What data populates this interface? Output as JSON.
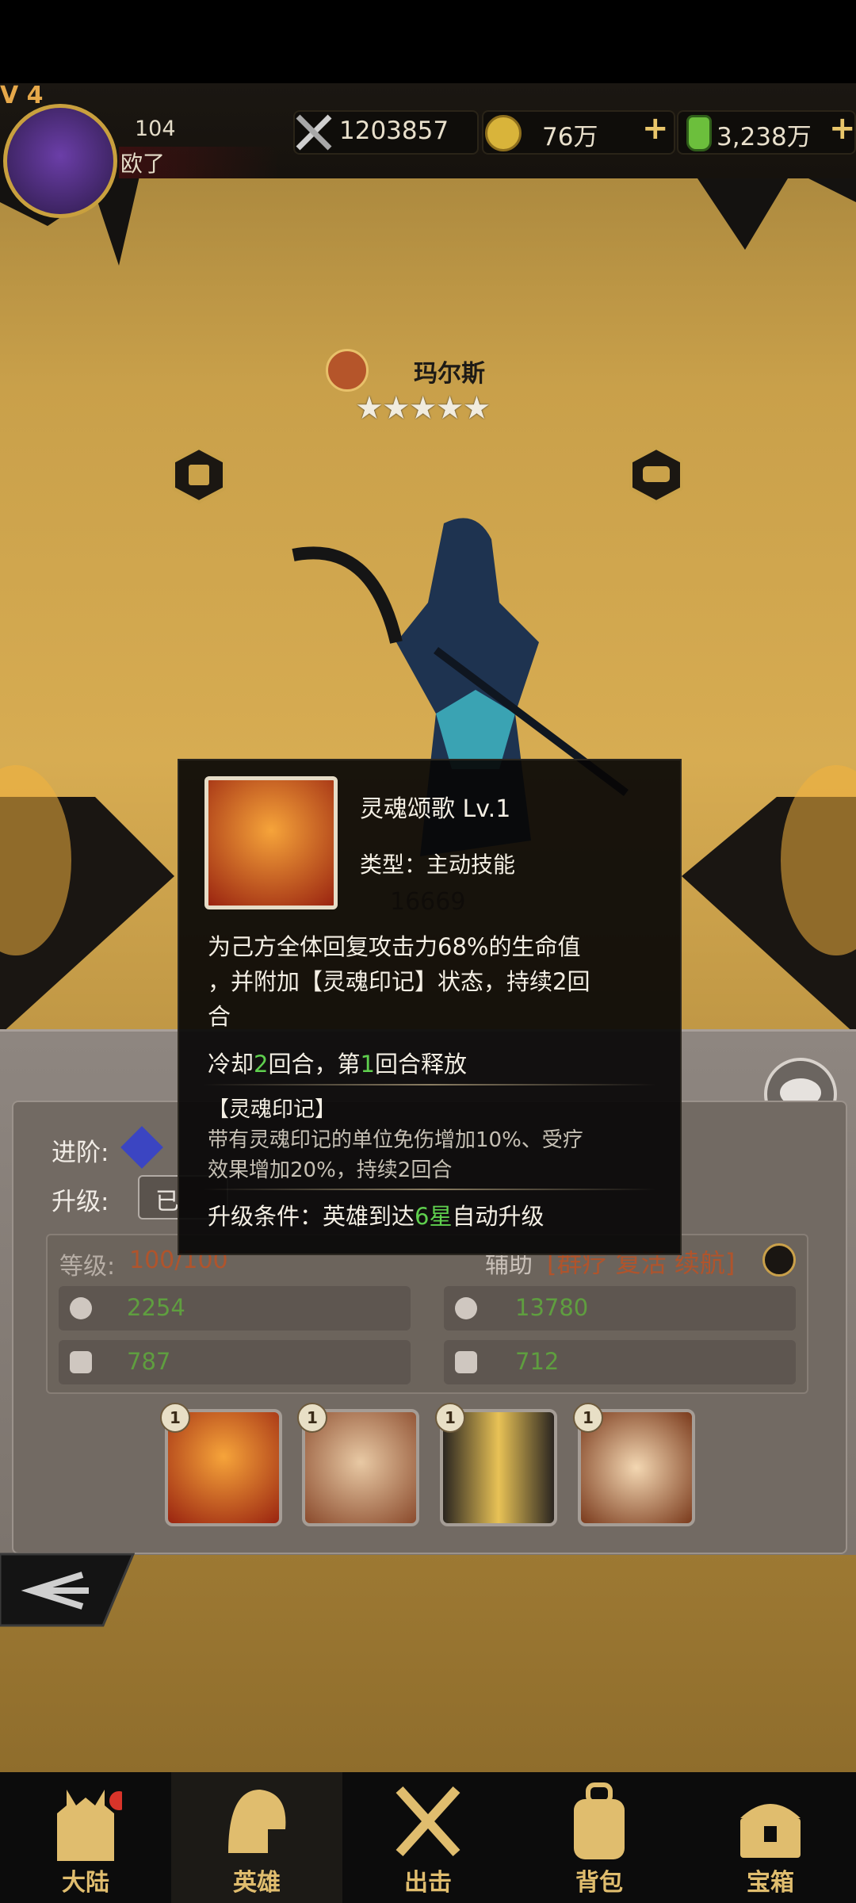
{
  "player": {
    "level_label": "V 4",
    "power": "104",
    "name": "欧了"
  },
  "currencies": {
    "combat_power": "1203857",
    "gold": "76万",
    "potion": "3,238万",
    "plus_symbol": "+"
  },
  "hero": {
    "name": "玛尔斯",
    "stars": [
      "★",
      "★",
      "★",
      "★",
      "★"
    ],
    "hidden_power": "16669"
  },
  "tooltip": {
    "skill_name": "灵魂颂歌 Lv.1",
    "type_label": "类型：主动技能",
    "description_l1": "为己方全体回复攻击力68%的生命值",
    "description_l2": "，并附加【灵魂印记】状态，持续2回",
    "description_l3": "合",
    "cooldown_a": "冷却",
    "cooldown_b": "2",
    "cooldown_c": "回合，第",
    "cooldown_d": "1",
    "cooldown_e": "回合释放",
    "mark_title": "【灵魂印记】",
    "mark_l1": "带有灵魂印记的单位免伤增加10%、受疗",
    "mark_l2": "效果增加20%，持续2回合",
    "upgrade_a": "升级条件：英雄到达",
    "upgrade_b": "6星",
    "upgrade_c": "自动升级"
  },
  "panel": {
    "advance_label": "进阶:",
    "upgrade_label": "升级:",
    "upgrade_btn": "已",
    "level_label": "等级:",
    "level_value": "100/100",
    "role_label": "辅助",
    "role_tags": "[群疗 复活 续航]",
    "attack": "2254",
    "hp": "13780",
    "defense": "787",
    "speed": "712",
    "skill_levels": [
      "1",
      "1",
      "1",
      "1"
    ]
  },
  "nav": {
    "items": [
      "大陆",
      "英雄",
      "出击",
      "背包",
      "宝箱"
    ]
  },
  "colors": {
    "accent_gold": "#e0bd6e",
    "green_text": "#5fcf4e",
    "stat_green": "#5f9e3f",
    "level_orange": "#b0542c"
  },
  "icons": [
    "swords-icon",
    "coin-icon",
    "potion-icon",
    "plus-icon",
    "emblem-icon",
    "armor-icon",
    "chat-icon",
    "chat-bubble-icon",
    "back-arrow-icon",
    "castle-icon",
    "helmet-icon",
    "crossed-swords-icon",
    "backpack-icon",
    "chest-icon",
    "star-icon",
    "crystal-icon",
    "sword-stat-icon",
    "heart-icon",
    "shield-icon",
    "boot-icon",
    "help-icon"
  ]
}
